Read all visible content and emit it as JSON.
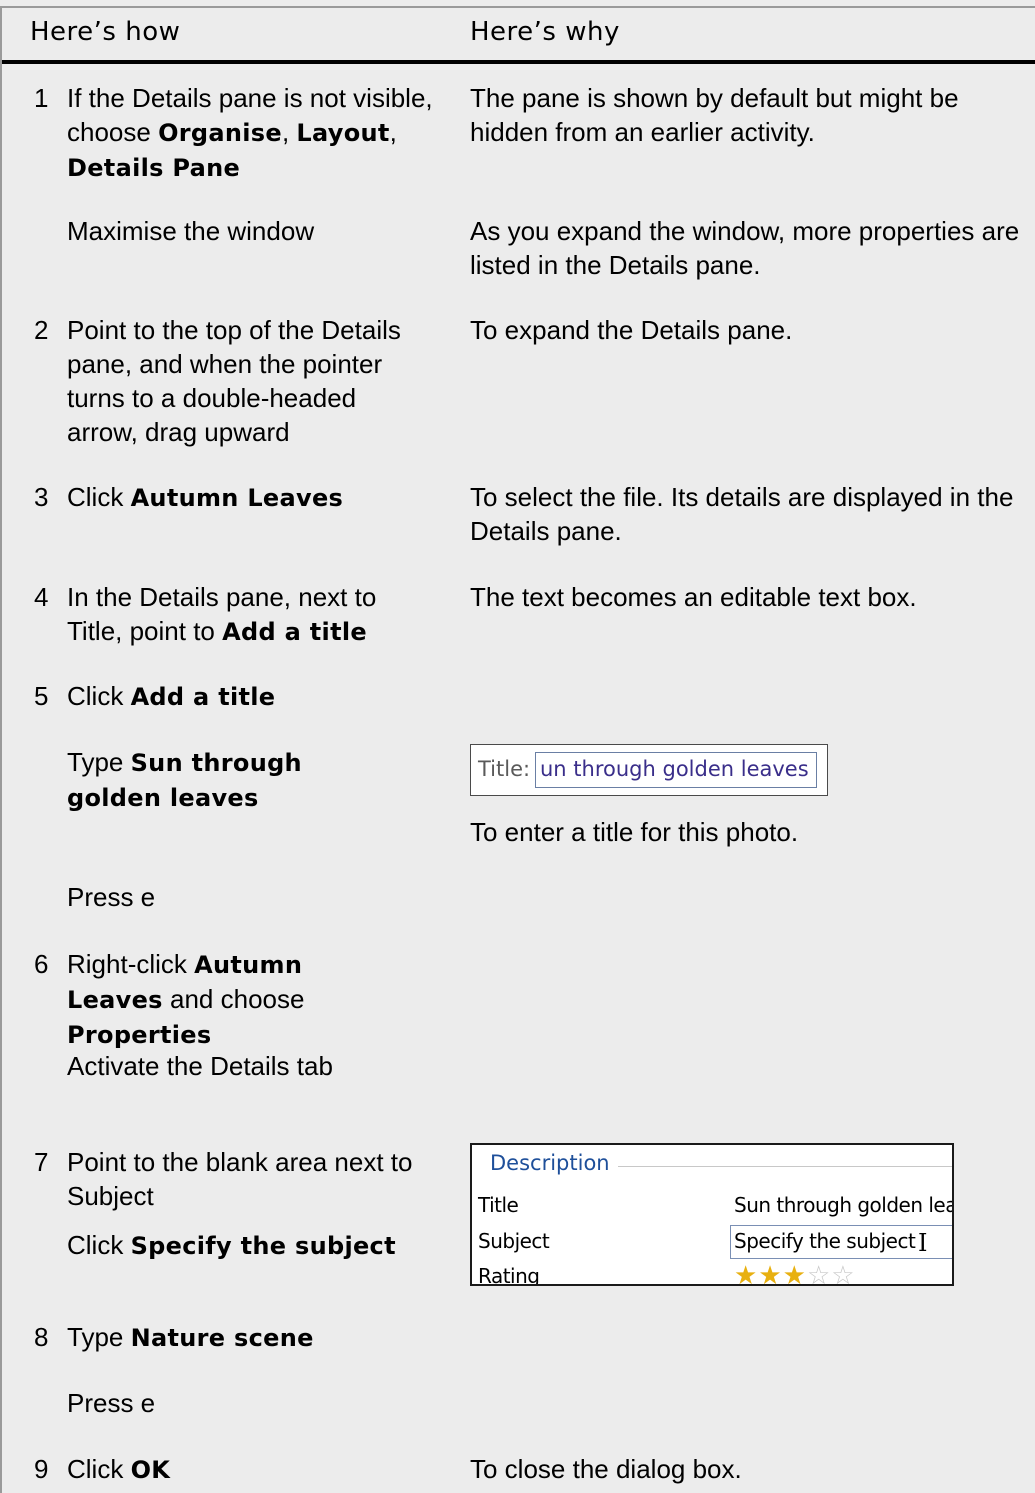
{
  "header": {
    "how": "Here’s how",
    "why": "Here’s why"
  },
  "steps": [
    {
      "num": "1",
      "how_parts": [
        "If the Details pane is not visible, choose ",
        "Organise",
        ", ",
        "Layout",
        ", ",
        "Details Pane"
      ],
      "why": "The pane is shown by default but might be hidden from an earlier activity."
    },
    {
      "num": "",
      "how": "Maximise the window",
      "why": "As you expand the window, more properties are listed in the Details pane."
    },
    {
      "num": "2",
      "how": "Point to the top of the Details pane, and when the pointer turns to a double-headed arrow, drag upward",
      "why": "To expand the Details pane."
    },
    {
      "num": "3",
      "how_pre": "Click ",
      "how_bold": "Autumn Leaves",
      "why": "To select the file. Its details are displayed in the Details pane."
    },
    {
      "num": "4",
      "how_pre": "In the Details pane, next to Title, point to ",
      "how_bold": "Add a title",
      "why": "The text becomes an editable text box."
    },
    {
      "num": "5",
      "how_pre": "Click ",
      "how_bold": "Add a title"
    },
    {
      "num": "",
      "how_pre": "Type ",
      "how_bold": "Sun through golden leaves",
      "why": "To enter a title for this photo."
    },
    {
      "num": "",
      "how": "Press e"
    },
    {
      "num": "6",
      "how_parts": [
        "Right-click ",
        "Autumn Leaves",
        " and choose ",
        "Properties"
      ]
    },
    {
      "num": "",
      "how": "Activate the Details tab"
    },
    {
      "num": "7",
      "how": "Point to the blank area next to Subject",
      "how2_pre": "Click ",
      "how2_bold": "Specify the subject"
    },
    {
      "num": "8",
      "how_pre": "Type ",
      "how_bold": "Nature scene"
    },
    {
      "num": "",
      "how": "Press e"
    },
    {
      "num": "9",
      "how_pre": "Click ",
      "how_bold": "OK",
      "why": "To close the dialog box."
    }
  ],
  "title_screenshot": {
    "label": "Title:",
    "value": "un through golden leaves"
  },
  "details_screenshot": {
    "section": "Description",
    "rows": [
      {
        "key": "Title",
        "value": "Sun through golden lea"
      },
      {
        "key": "Subject",
        "value": "Specify the subject"
      },
      {
        "key": "Rating",
        "stars": 3,
        "max_stars": 5
      }
    ]
  }
}
